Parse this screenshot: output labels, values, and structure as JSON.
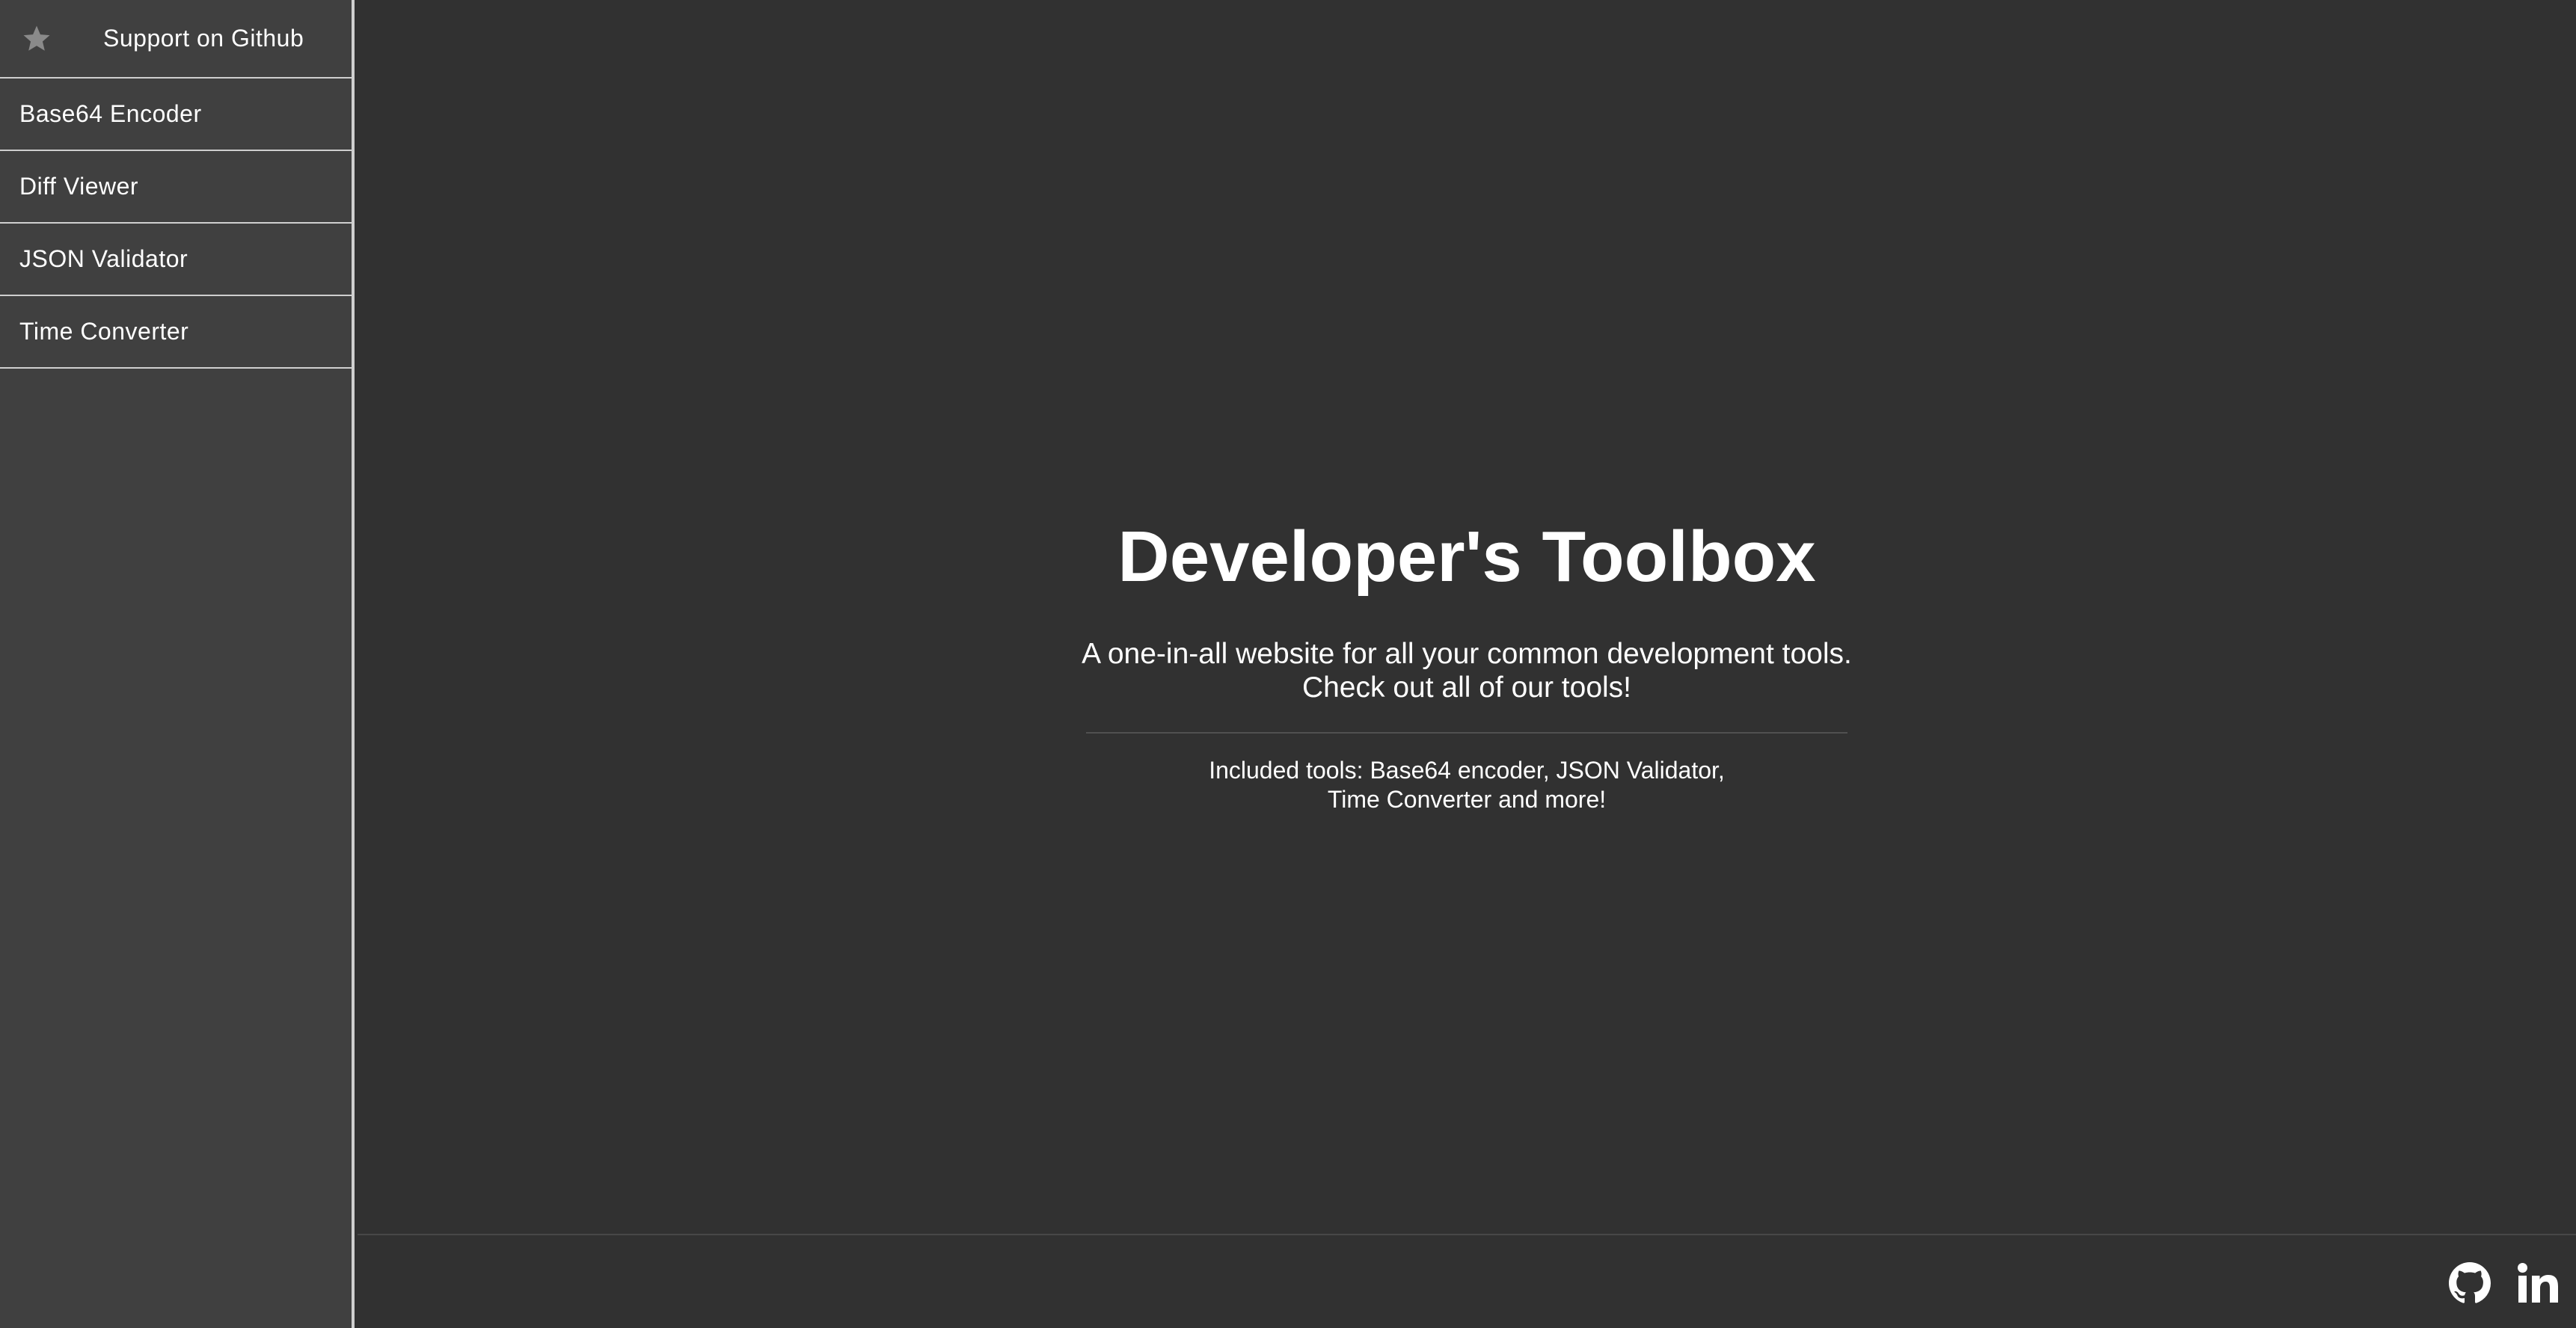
{
  "sidebar": {
    "github": {
      "label": "Support on Github",
      "icon": "star-icon"
    },
    "items": [
      {
        "label": "Base64 Encoder"
      },
      {
        "label": "Diff Viewer"
      },
      {
        "label": "JSON Validator"
      },
      {
        "label": "Time Converter"
      }
    ]
  },
  "hero": {
    "title": "Developer's Toolbox",
    "subtitle_line1": "A one-in-all website for all your common development tools.",
    "subtitle_line2": "Check out all of our tools!",
    "included_line1": "Included tools: Base64 encoder, JSON Validator,",
    "included_line2": "Time Converter and more!"
  },
  "footer": {
    "links": [
      {
        "icon": "github-icon"
      },
      {
        "icon": "linkedin-icon"
      }
    ]
  },
  "colors": {
    "background": "#313131",
    "sidebar": "#404040",
    "text": "#ffffff",
    "border": "#cfcfcf",
    "icon_muted": "#8a8a8a"
  }
}
